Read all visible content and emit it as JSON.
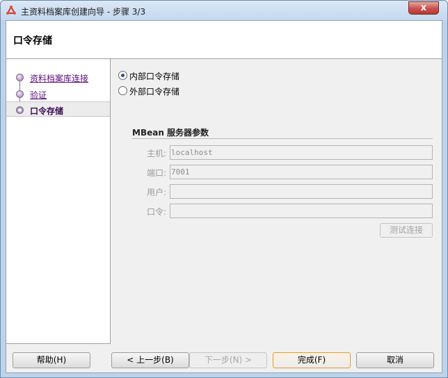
{
  "window": {
    "title": "主资料档案库创建向导 - 步骤 3/3",
    "close_glyph": "x"
  },
  "header": {
    "title": "口令存储"
  },
  "nav": {
    "steps": [
      {
        "label": "资料档案库连接",
        "state": "visited"
      },
      {
        "label": "验证",
        "state": "visited"
      },
      {
        "label": "口令存储",
        "state": "current"
      }
    ]
  },
  "password_storage": {
    "options": [
      {
        "label": "内部口令存储",
        "checked": true
      },
      {
        "label": "外部口令存储",
        "checked": false
      }
    ]
  },
  "mbean": {
    "section_title": "MBean 服务器参数",
    "host_label": "主机:",
    "host_value": "localhost",
    "port_label": "端口:",
    "port_value": "7001",
    "user_label": "用户:",
    "user_value": "",
    "password_label": "口令:",
    "password_value": "",
    "test_button": "测试连接"
  },
  "buttons": {
    "help": "帮助(H)",
    "back": "< 上一步(B)",
    "next": "下一步(N) >",
    "finish": "完成(F)",
    "cancel": "取消"
  },
  "colors": {
    "accent_link": "#5b0f7a",
    "step_node": "#b39bc6",
    "default_button_border": "#e39b32",
    "close_button": "#c75050"
  }
}
